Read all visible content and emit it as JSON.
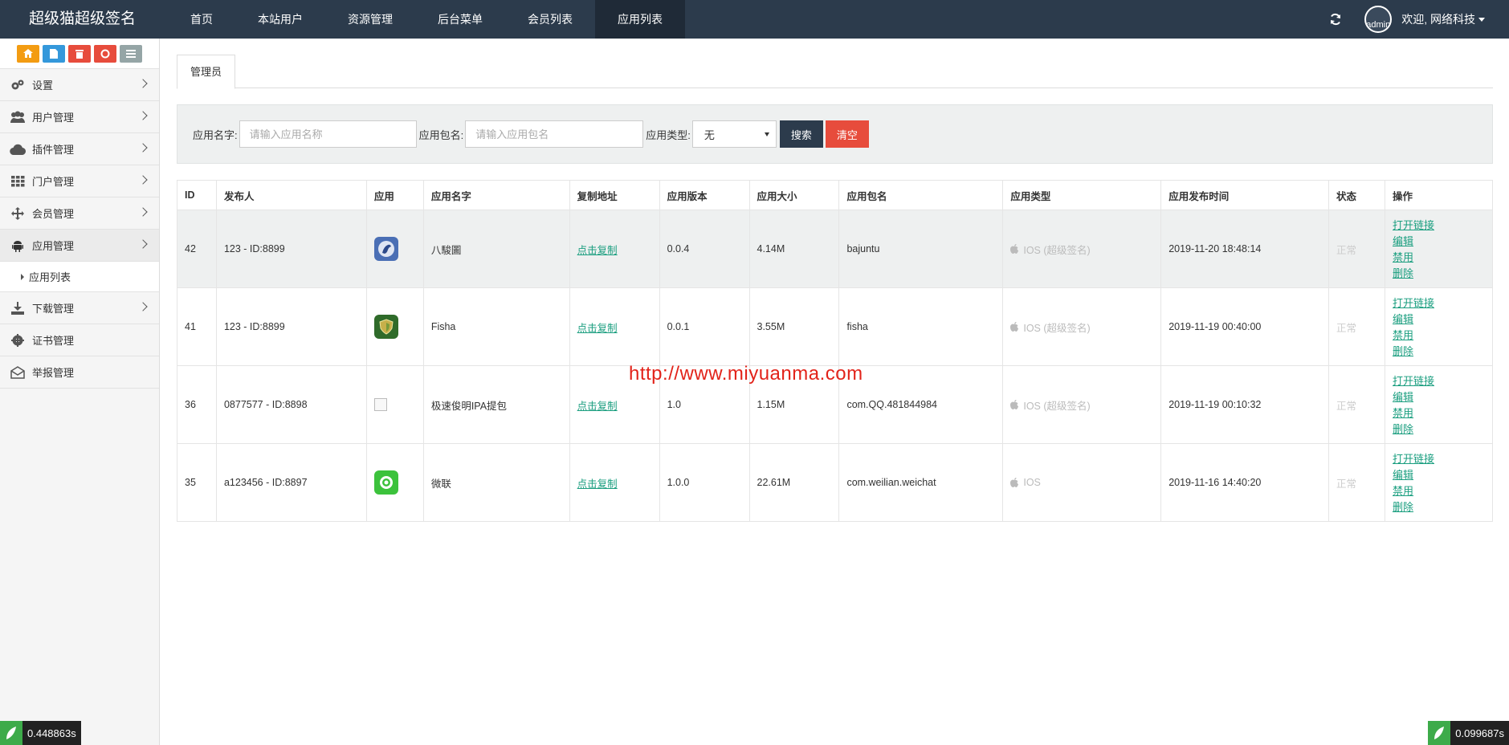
{
  "brand": "超级猫超级签名",
  "nav": [
    "首页",
    "本站用户",
    "资源管理",
    "后台菜单",
    "会员列表",
    "应用列表"
  ],
  "header": {
    "avatar_alt": "admin",
    "welcome": "欢迎, 网络科技"
  },
  "sidebar": {
    "items": [
      {
        "label": "设置",
        "icon": "gears-icon"
      },
      {
        "label": "用户管理",
        "icon": "users-icon"
      },
      {
        "label": "插件管理",
        "icon": "cloud-icon"
      },
      {
        "label": "门户管理",
        "icon": "grid-icon"
      },
      {
        "label": "会员管理",
        "icon": "arrows-icon"
      },
      {
        "label": "应用管理",
        "icon": "android-icon"
      },
      {
        "label": "下载管理",
        "icon": "download-icon"
      },
      {
        "label": "证书管理",
        "icon": "cog-icon"
      },
      {
        "label": "举报管理",
        "icon": "envelope-icon"
      }
    ],
    "submenu": "应用列表"
  },
  "tab": "管理员",
  "filter": {
    "name_label": "应用名字:",
    "name_placeholder": "请输入应用名称",
    "package_label": "应用包名:",
    "package_placeholder": "请输入应用包名",
    "type_label": "应用类型:",
    "type_value": "无",
    "search": "搜索",
    "clear": "清空"
  },
  "table": {
    "headers": [
      "ID",
      "发布人",
      "应用",
      "应用名字",
      "复制地址",
      "应用版本",
      "应用大小",
      "应用包名",
      "应用类型",
      "应用发布时间",
      "状态",
      "操作"
    ],
    "rows": [
      {
        "id": "42",
        "publisher": "123 - ID:8899",
        "name": "八駿圖",
        "copy": "点击复制",
        "version": "0.0.4",
        "size": "4.14M",
        "package": "bajuntu",
        "type": "IOS (超级签名)",
        "time": "2019-11-20 18:48:14",
        "status": "正常",
        "icon": "horse-icon"
      },
      {
        "id": "41",
        "publisher": "123 - ID:8899",
        "name": "Fisha",
        "copy": "点击复制",
        "version": "0.0.1",
        "size": "3.55M",
        "package": "fisha",
        "type": "IOS (超级签名)",
        "time": "2019-11-19 00:40:00",
        "status": "正常",
        "icon": "shield-icon"
      },
      {
        "id": "36",
        "publisher": "0877577 - ID:8898",
        "name": "极速俊明IPA提包",
        "copy": "点击复制",
        "version": "1.0",
        "size": "1.15M",
        "package": "com.QQ.481844984",
        "type": "IOS (超级签名)",
        "time": "2019-11-19 00:10:32",
        "status": "正常",
        "icon": "broken-image-icon"
      },
      {
        "id": "35",
        "publisher": "a123456 - ID:8897",
        "name": "微联",
        "copy": "点击复制",
        "version": "1.0.0",
        "size": "22.61M",
        "package": "com.weilian.weichat",
        "type": "IOS",
        "time": "2019-11-16 14:40:20",
        "status": "正常",
        "icon": "chat-icon"
      }
    ],
    "ops": [
      "打开链接",
      "编辑",
      "禁用",
      "删除"
    ]
  },
  "watermark": "http://www.miyuanma.com",
  "timers": {
    "left": "0.448863s",
    "right": "0.099687s"
  },
  "colors": {
    "topbar": "#2c3b4c",
    "link": "#1a9e7f",
    "danger": "#e74c3c"
  }
}
